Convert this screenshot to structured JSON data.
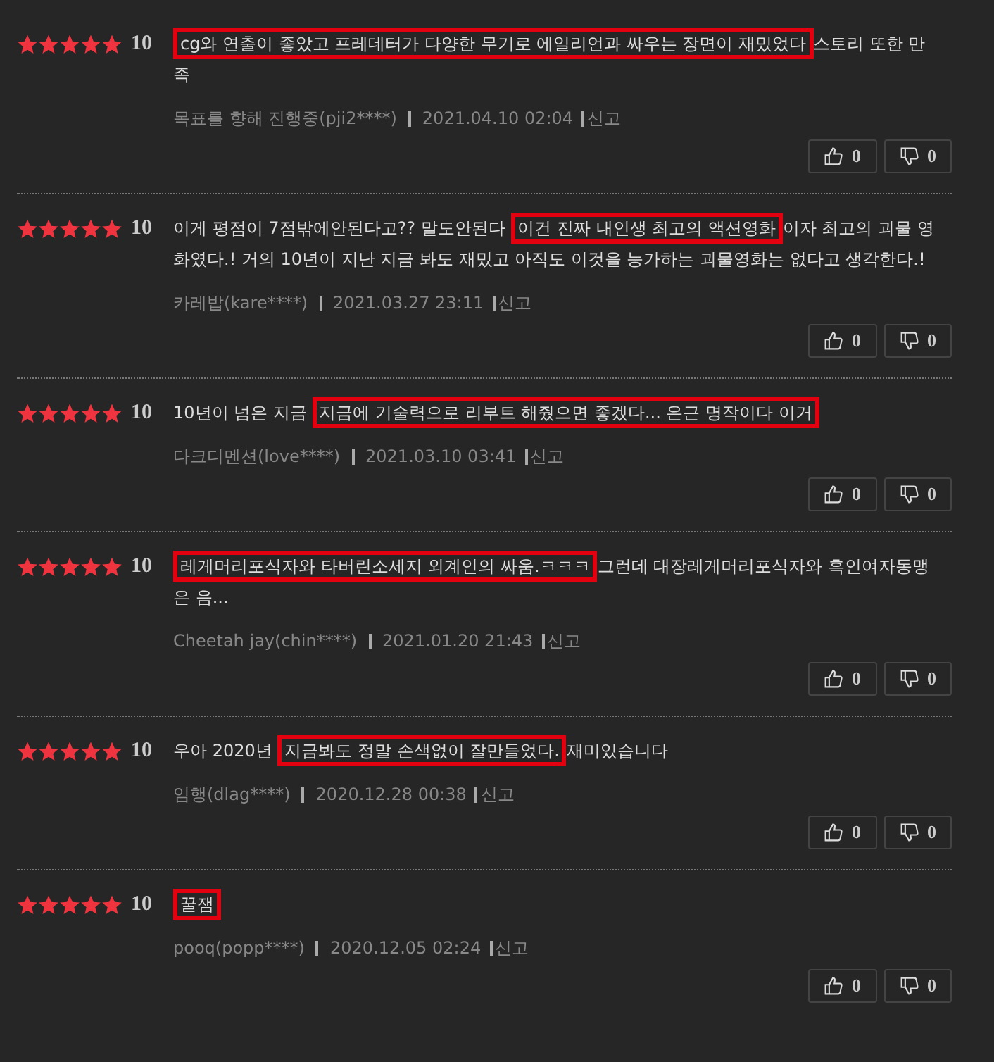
{
  "reviews": [
    {
      "stars": 5,
      "score": "10",
      "highlight": "cg와 연출이 좋았고 프레데터가 다양한 무기로 에일리언과 싸우는 장면이 재밌었다",
      "text_after": "스토리 또한 만족",
      "author": "목표를 향해 진행중(pji2****)",
      "date": "2021.04.10 02:04",
      "report": "신고",
      "likes": "0",
      "dislikes": "0"
    },
    {
      "stars": 5,
      "score": "10",
      "text_before": "이게 평점이 7점밖에안된다고?? 말도안된다 ",
      "highlight": "이건 진짜 내인생 최고의 액션영화",
      "text_after": "이자 최고의 괴물 영화였다.! 거의 10년이 지난 지금 봐도 재밌고 아직도 이것을 능가하는 괴물영화는 없다고 생각한다.!",
      "author": "카레밥(kare****)",
      "date": "2021.03.27 23:11",
      "report": "신고",
      "likes": "0",
      "dislikes": "0"
    },
    {
      "stars": 5,
      "score": "10",
      "text_before": "10년이 넘은 지금 ",
      "highlight": "지금에 기술력으로 리부트 해줬으면 좋겠다... 은근 명작이다 이거",
      "author": "다크디멘션(love****)",
      "date": "2021.03.10 03:41",
      "report": "신고",
      "likes": "0",
      "dislikes": "0"
    },
    {
      "stars": 5,
      "score": "10",
      "highlight": "레게머리포식자와 타버린소세지 외계인의 싸움.ㅋㅋㅋ",
      "text_after": "그런데 대장레게머리포식자와 흑인여자동맹은 음...",
      "author": "Cheetah jay(chin****)",
      "date": "2021.01.20 21:43",
      "report": "신고",
      "likes": "0",
      "dislikes": "0"
    },
    {
      "stars": 5,
      "score": "10",
      "text_before": "우아 2020년 ",
      "highlight": "지금봐도 정말 손색없이 잘만들었다.",
      "text_after": "재미있습니다",
      "author": "임행(dlag****)",
      "date": "2020.12.28 00:38",
      "report": "신고",
      "likes": "0",
      "dislikes": "0"
    },
    {
      "stars": 5,
      "score": "10",
      "highlight": "꿀잼",
      "author": "pooq(popp****)",
      "date": "2020.12.05 02:24",
      "report": "신고",
      "likes": "0",
      "dislikes": "0"
    }
  ]
}
